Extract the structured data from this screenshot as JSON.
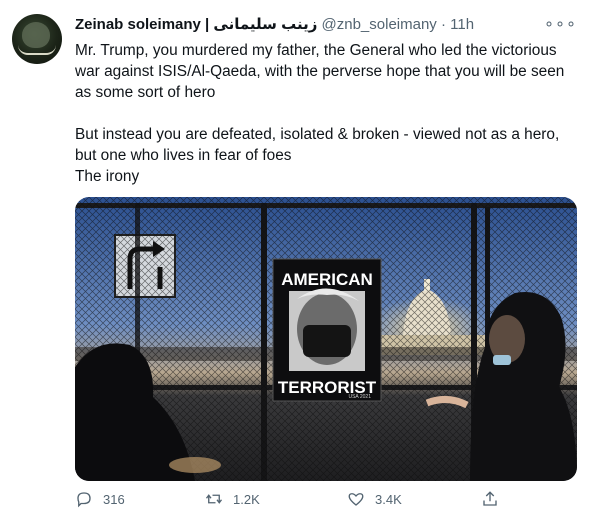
{
  "tweet": {
    "display_name": "Zeinab soleimany | زینب سلیمانی",
    "handle": "@znb_soleimany",
    "separator": "·",
    "time": "11h",
    "more_label": "∘∘∘",
    "paragraphs": [
      "Mr. Trump, you murdered my father, the General who led the victorious war against ISIS/Al-Qaeda, with the perverse hope that you will be seen as some sort of hero",
      "But instead you are defeated, isolated & broken - viewed not as a hero, but one who lives in fear of foes",
      "The irony"
    ],
    "poster": {
      "top_text": "AMERICAN",
      "bottom_text": "TERRORIST",
      "credit": "USA 2021"
    },
    "stats": {
      "replies": "316",
      "retweets": "1.2K",
      "likes": "3.4K"
    }
  },
  "icons": {
    "reply": "reply-icon",
    "retweet": "retweet-icon",
    "like": "heart-icon",
    "share": "share-icon",
    "more": "more-icon"
  },
  "colors": {
    "text": "#0f1419",
    "secondary": "#536471"
  }
}
